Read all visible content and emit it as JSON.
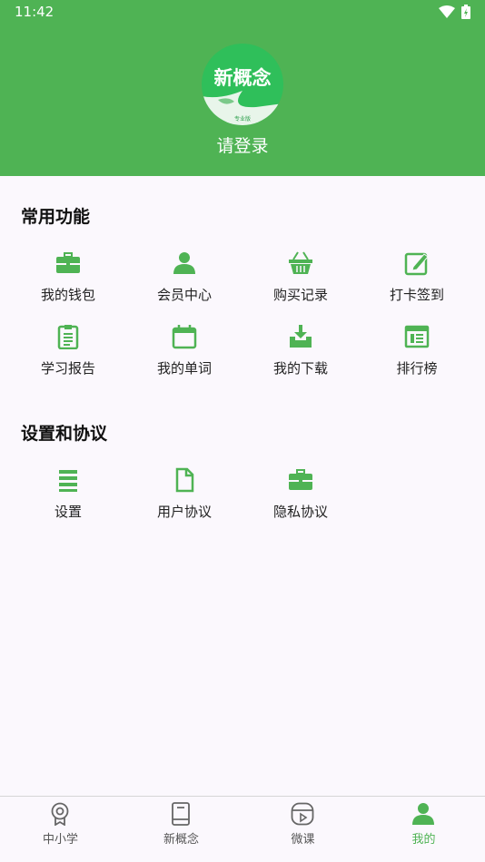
{
  "status_bar": {
    "time": "11:42"
  },
  "header": {
    "logo_text": "新概念",
    "logo_subtext": "专业版",
    "login_label": "请登录"
  },
  "sections": [
    {
      "title": "常用功能",
      "items": [
        {
          "label": "我的钱包",
          "icon": "wallet-icon"
        },
        {
          "label": "会员中心",
          "icon": "member-icon"
        },
        {
          "label": "购买记录",
          "icon": "basket-icon"
        },
        {
          "label": "打卡签到",
          "icon": "checkin-icon"
        },
        {
          "label": "学习报告",
          "icon": "report-icon"
        },
        {
          "label": "我的单词",
          "icon": "calendar-icon"
        },
        {
          "label": "我的下载",
          "icon": "download-icon"
        },
        {
          "label": "排行榜",
          "icon": "ranking-icon"
        }
      ]
    },
    {
      "title": "设置和协议",
      "items": [
        {
          "label": "设置",
          "icon": "settings-list-icon"
        },
        {
          "label": "用户协议",
          "icon": "document-icon"
        },
        {
          "label": "隐私协议",
          "icon": "briefcase-icon"
        }
      ]
    }
  ],
  "tabbar": {
    "tabs": [
      {
        "label": "中小学",
        "icon": "medal-icon",
        "active": false
      },
      {
        "label": "新概念",
        "icon": "book-icon",
        "active": false
      },
      {
        "label": "微课",
        "icon": "video-icon",
        "active": false
      },
      {
        "label": "我的",
        "icon": "person-icon",
        "active": true
      }
    ]
  },
  "colors": {
    "accent": "#4fb354",
    "background": "#fbf8fd"
  }
}
